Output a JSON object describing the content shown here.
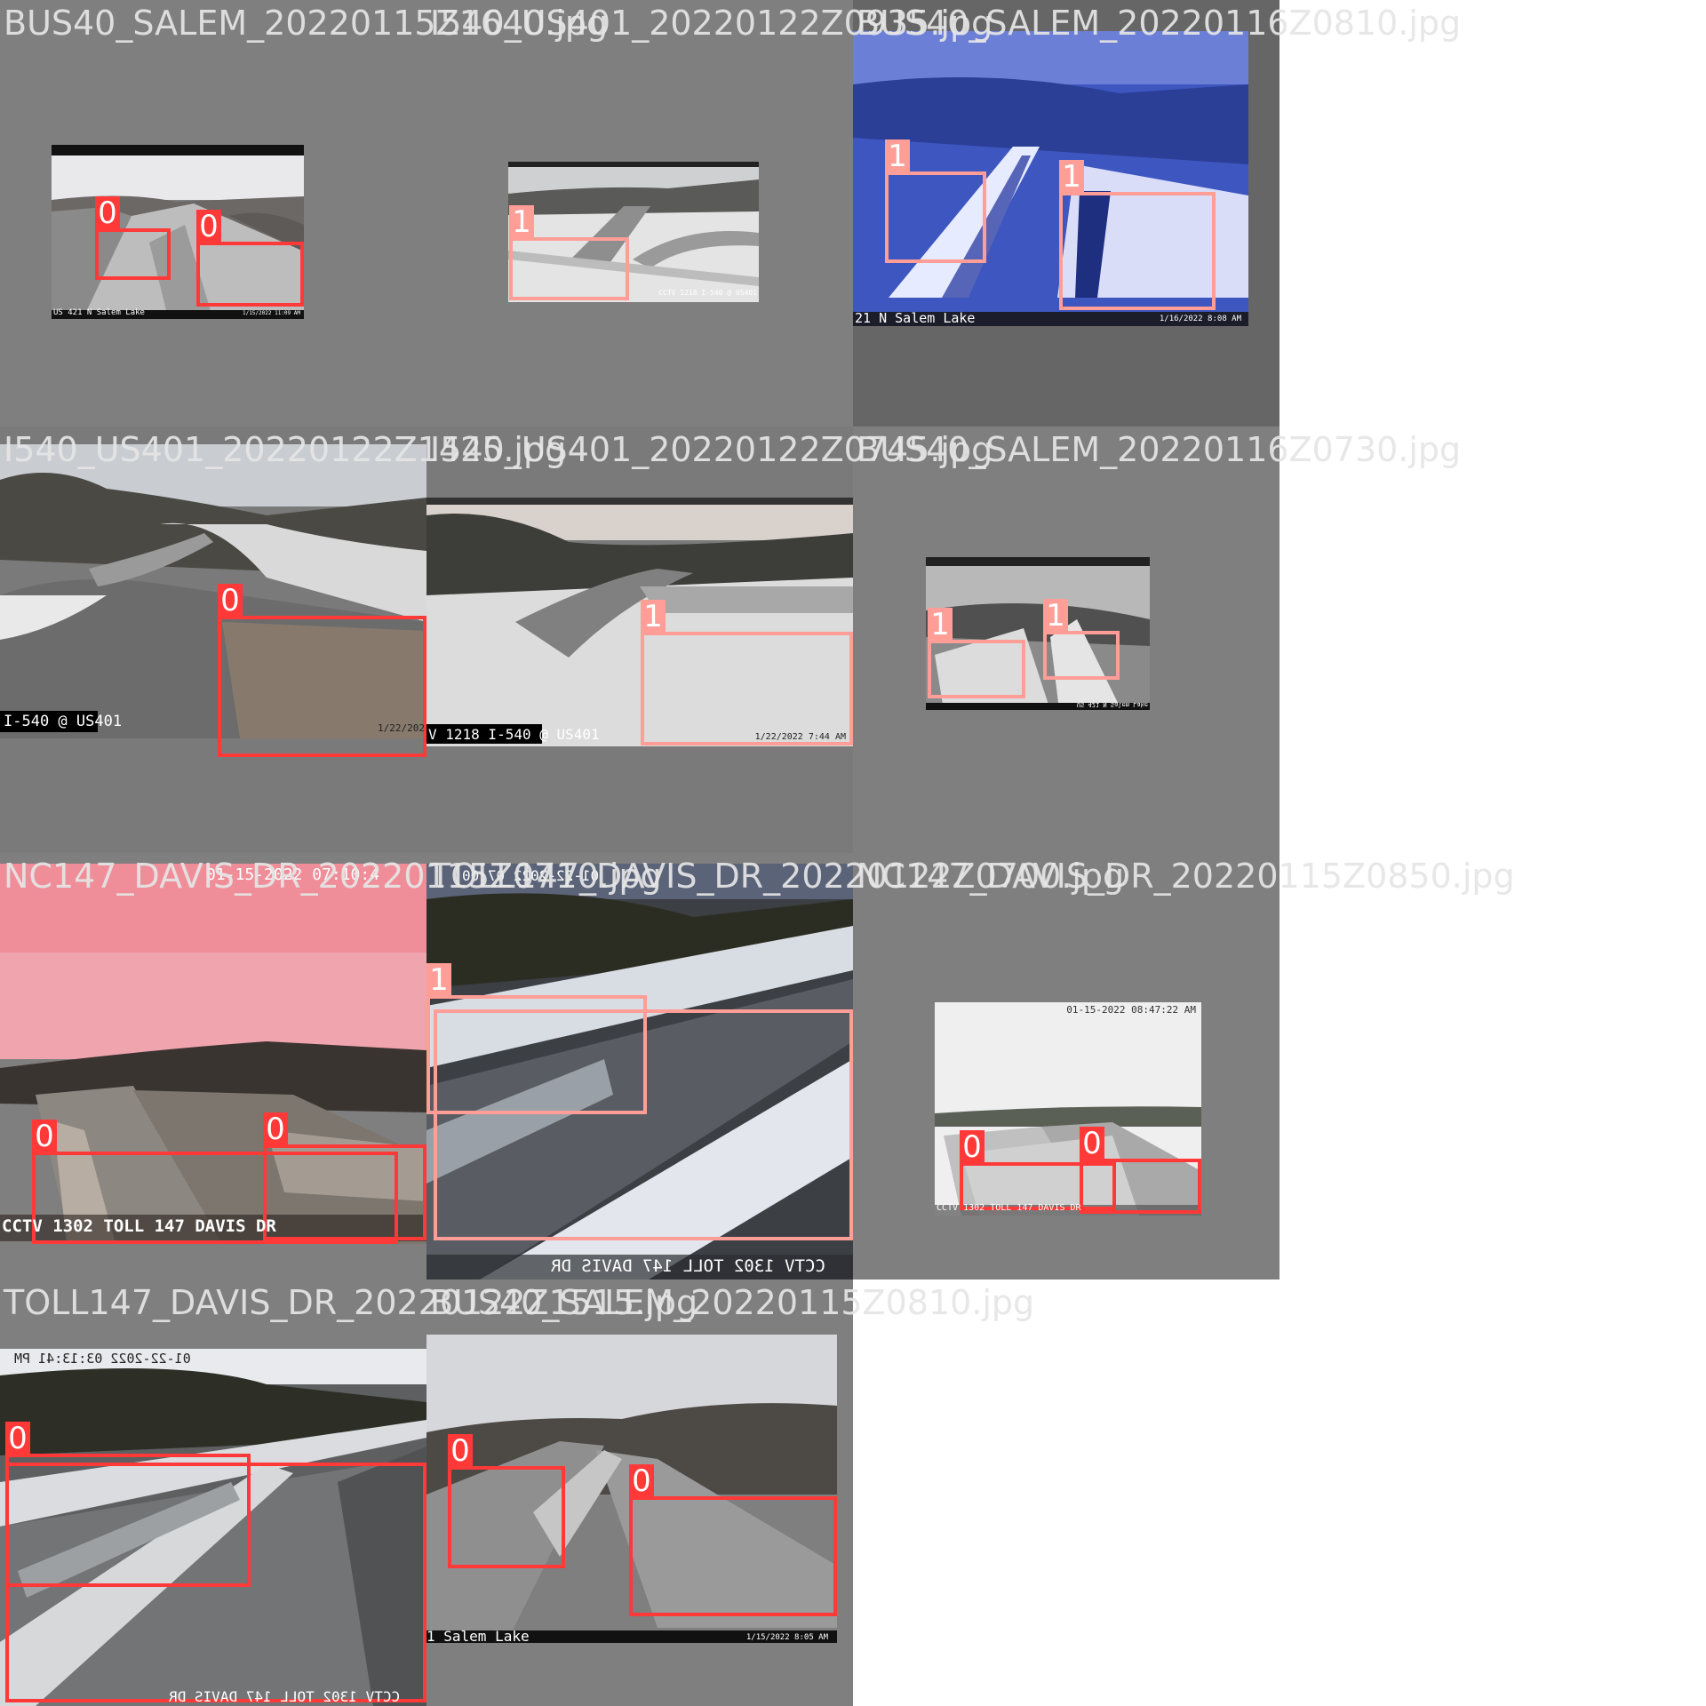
{
  "mosaic": {
    "tiles": [
      {
        "filename": "BUS40_SALEM_20220115Z1640.jpg",
        "camera_text": "US 421 N Salem Lake",
        "timestamp_text": "1/15/2022 11:09 AM",
        "detections": [
          {
            "cls": "0"
          },
          {
            "cls": "0"
          }
        ]
      },
      {
        "filename": "I540_US401_20220122Z0935.jpg",
        "camera_text": "CCTV 1218 I-540 @ US401",
        "timestamp_text": "",
        "detections": [
          {
            "cls": "1"
          }
        ]
      },
      {
        "filename": "BUS40_SALEM_20220116Z0810.jpg",
        "camera_text": "21 N Salem Lake",
        "timestamp_text": "1/16/2022 8:08 AM",
        "detections": [
          {
            "cls": "1"
          },
          {
            "cls": "1"
          }
        ]
      },
      {
        "filename": "I540_US401_20220122Z1425.jpg",
        "camera_text": "I-540 @ US401",
        "timestamp_text": "1/22/202",
        "detections": [
          {
            "cls": "0"
          }
        ]
      },
      {
        "filename": "I540_US401_20220122Z0745.jpg",
        "camera_text": "V 1218 I-540 @ US401",
        "timestamp_text": "1/22/2022 7:44 AM",
        "detections": [
          {
            "cls": "1"
          }
        ]
      },
      {
        "filename": "BUS40_SALEM_20220116Z0730.jpg",
        "camera_text": "US 421 N Salem Lake",
        "timestamp_text": "",
        "detections": [
          {
            "cls": "1"
          },
          {
            "cls": "1"
          }
        ]
      },
      {
        "filename": "NC147_DAVIS_DR_20220115Z0710.jpg",
        "camera_text": "CCTV 1302 TOLL 147 DAVIS DR",
        "timestamp_text": "01-15-2022 07:10:4",
        "detections": [
          {
            "cls": "0"
          },
          {
            "cls": "0"
          }
        ]
      },
      {
        "filename": "TOLL147_DAVIS_DR_20220122Z0700.jpg",
        "camera_text": "CCTV 1302 TOLL 147 DAVIS DR",
        "timestamp_text": "01-22-2022 07:00",
        "detections": [
          {
            "cls": "1"
          },
          {
            "cls": "1"
          }
        ]
      },
      {
        "filename": "NC147_DAVIS_DR_20220115Z0850.jpg",
        "camera_text": "CCTV 1302 TOLL 147 DAVIS DR",
        "timestamp_text": "01-15-2022 08:47:22 AM",
        "detections": [
          {
            "cls": "0"
          },
          {
            "cls": "0"
          }
        ]
      },
      {
        "filename": "TOLL147_DAVIS_DR_20220122Z1515.jpg",
        "camera_text": "CCTV 1302 TOLL 147 DAVIS DR",
        "timestamp_text": "01-22-2022 03:13:41 PM",
        "detections": [
          {
            "cls": "0"
          },
          {
            "cls": "1"
          }
        ]
      },
      {
        "filename": "BUS40_SALEM_20220115Z0810.jpg",
        "camera_text": "1 Salem Lake",
        "timestamp_text": "1/15/2022 8:05 AM",
        "detections": [
          {
            "cls": "0"
          },
          {
            "cls": "0"
          }
        ]
      }
    ],
    "colors": {
      "class0": "#ff3838",
      "class1": "#ff9d97",
      "tile_bg": "#808080",
      "label_text": "#e6e6e6"
    }
  }
}
